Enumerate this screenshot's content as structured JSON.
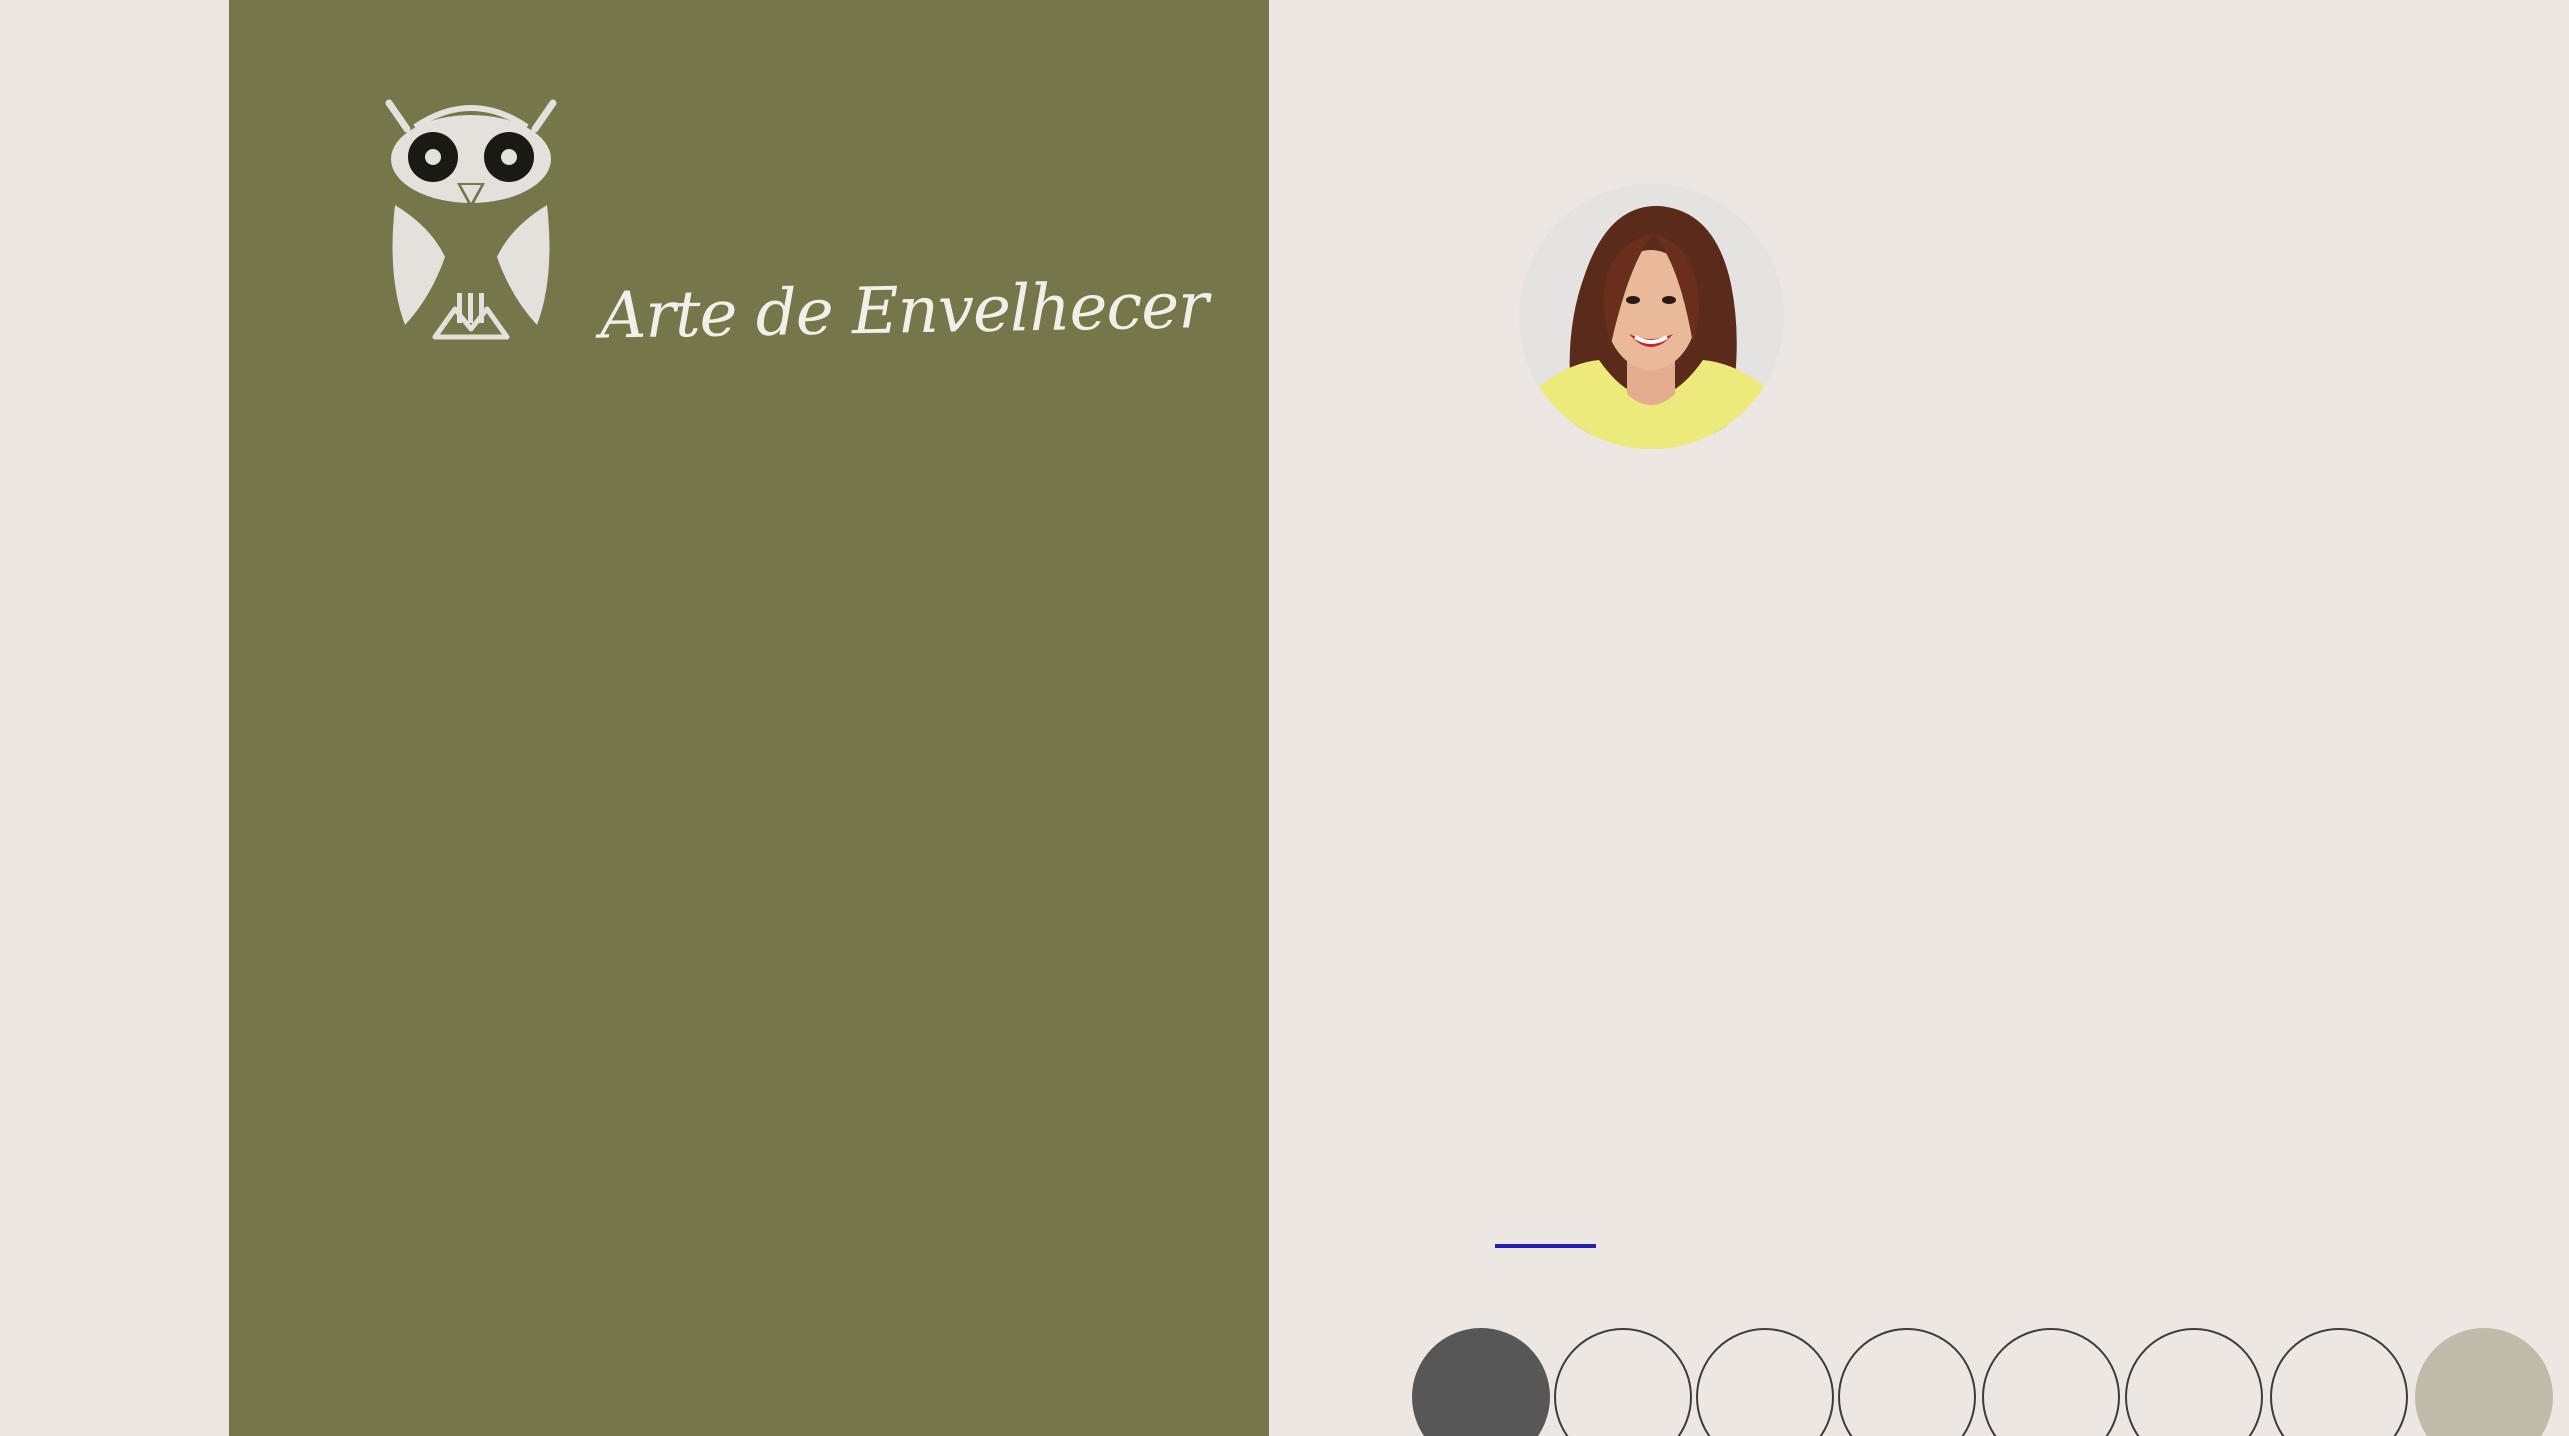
{
  "brand": {
    "name": "Arte de Envelhecer",
    "logo_icon": "owl-icon"
  },
  "profile": {
    "avatar_icon": "person-photo"
  },
  "colors": {
    "page_bg": "#ece7e3",
    "panel_bg": "#75764a",
    "logo_color": "#e3e1db",
    "link_color": "#2020b8"
  },
  "carousel": {
    "dots": [
      {
        "state": "active",
        "color": "#575757"
      },
      {
        "state": "inactive",
        "color": "transparent"
      },
      {
        "state": "inactive",
        "color": "transparent"
      },
      {
        "state": "inactive",
        "color": "transparent"
      },
      {
        "state": "inactive",
        "color": "transparent"
      },
      {
        "state": "inactive",
        "color": "transparent"
      },
      {
        "state": "inactive",
        "color": "transparent"
      },
      {
        "state": "highlight",
        "color": "#bebba8"
      }
    ]
  }
}
